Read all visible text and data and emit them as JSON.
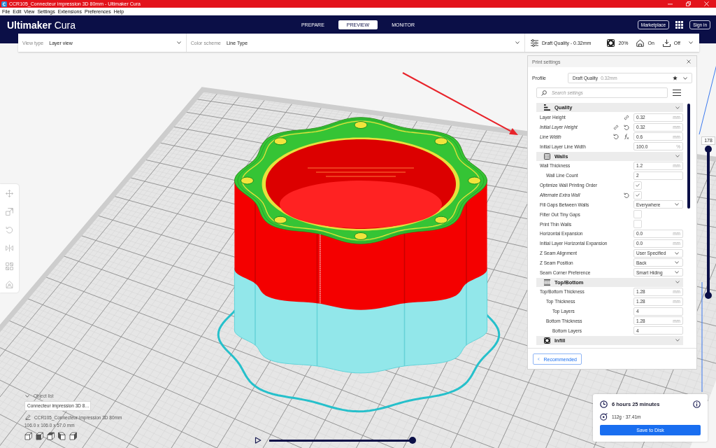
{
  "window": {
    "title": "CCR105_Connecteur impression 3D 80mm - Ultimaker Cura"
  },
  "menu": [
    "File",
    "Edit",
    "View",
    "Settings",
    "Extensions",
    "Preferences",
    "Help"
  ],
  "header": {
    "logo": "**Ultimaker** Cura",
    "tabs": [
      {
        "label": "PREPARE",
        "selected": false
      },
      {
        "label": "PREVIEW",
        "selected": true
      },
      {
        "label": "MONITOR",
        "selected": false
      }
    ],
    "marketplace": "Marketplace",
    "sign_in": "Sign in"
  },
  "view_bar": {
    "view_type": {
      "label": "View type",
      "value": "Layer view"
    },
    "color_scheme": {
      "label": "Color scheme",
      "value": "Line Type"
    },
    "print_setup": [
      {
        "kind": "profile",
        "value": "Draft Quality - 0.32mm"
      },
      {
        "kind": "infill",
        "value": "20%"
      },
      {
        "kind": "support",
        "value": "On"
      },
      {
        "kind": "adhesion",
        "value": "Off"
      }
    ]
  },
  "tools": [
    {
      "kind": "move",
      "disabled": true
    },
    {
      "kind": "scale",
      "disabled": true
    },
    {
      "kind": "rotate",
      "disabled": true
    },
    {
      "kind": "mirror",
      "disabled": true
    },
    {
      "kind": "permodel",
      "disabled": true
    },
    {
      "kind": "blocker",
      "disabled": true
    }
  ],
  "print_settings": {
    "title": "Print settings",
    "profile_label": "Profile",
    "profile": "Draft Quality",
    "profile_detail": "0.32mm",
    "search": {
      "placeholder": "Search settings"
    },
    "sections": [
      {
        "kind": "quality",
        "title": "Quality",
        "expanded": true,
        "settings": [
          {
            "label": "Layer Height",
            "kind": "number",
            "value": "0.32",
            "unit": "mm",
            "shared": true,
            "modified": false,
            "calculated": false
          },
          {
            "label": "Initial Layer Height",
            "kind": "number",
            "value": "0.32",
            "unit": "mm",
            "shared": true,
            "modified": true,
            "calculated": false
          },
          {
            "label": "Line Width",
            "kind": "number",
            "value": "0.6",
            "unit": "mm",
            "shared": false,
            "modified": true,
            "calculated": true
          },
          {
            "label": "Initial Layer Line Width",
            "kind": "number",
            "value": "100.0",
            "unit": "%",
            "shared": false,
            "modified": false,
            "calculated": false
          }
        ]
      },
      {
        "kind": "walls",
        "title": "Walls",
        "expanded": true,
        "settings": [
          {
            "label": "Wall Thickness",
            "kind": "number",
            "value": "1.2",
            "unit": "mm",
            "shared": false,
            "modified": false,
            "calculated": false,
            "children": [
              {
                "label": "Wall Line Count",
                "kind": "number",
                "value": "2",
                "shared": false,
                "modified": false,
                "calculated": false
              }
            ]
          },
          {
            "label": "Optimize Wall Printing Order",
            "kind": "checkbox",
            "checked": true,
            "shared": false,
            "modified": false,
            "calculated": false
          },
          {
            "label": "Alternate Extra Wall",
            "kind": "checkbox",
            "checked": true,
            "shared": false,
            "modified": true,
            "calculated": false
          },
          {
            "label": "Fill Gaps Between Walls",
            "kind": "dropdown",
            "value": "Everywhere",
            "shared": false,
            "modified": false,
            "calculated": false
          },
          {
            "label": "Filter Out Tiny Gaps",
            "kind": "checkbox",
            "checked": false,
            "shared": false,
            "modified": false,
            "calculated": false
          },
          {
            "label": "Print Thin Walls",
            "kind": "checkbox",
            "checked": false,
            "shared": false,
            "modified": false,
            "calculated": false
          },
          {
            "label": "Horizontal Expansion",
            "kind": "number",
            "value": "0.0",
            "unit": "mm",
            "shared": false,
            "modified": false,
            "calculated": false
          },
          {
            "label": "Initial Layer Horizontal Expansion",
            "kind": "number",
            "value": "0.0",
            "unit": "mm",
            "shared": false,
            "modified": false,
            "calculated": false
          },
          {
            "label": "Z Seam Alignment",
            "kind": "dropdown",
            "value": "User Specified",
            "shared": false,
            "modified": false,
            "calculated": false
          },
          {
            "label": "Z Seam Position",
            "kind": "dropdown",
            "value": "Back",
            "shared": false,
            "modified": false,
            "calculated": false
          },
          {
            "label": "Seam Corner Preference",
            "kind": "dropdown",
            "value": "Smart Hiding",
            "shared": false,
            "modified": false,
            "calculated": false
          }
        ]
      },
      {
        "kind": "topbottom",
        "title": "Top/Bottom",
        "expanded": true,
        "settings": [
          {
            "label": "Top/Bottom Thickness",
            "kind": "number",
            "value": "1.28",
            "unit": "mm",
            "shared": false,
            "modified": false,
            "calculated": false,
            "children": [
              {
                "label": "Top Thickness",
                "kind": "number",
                "value": "1.28",
                "unit": "mm",
                "shared": false,
                "modified": false,
                "calculated": false,
                "children": [
                  {
                    "label": "Top Layers",
                    "kind": "number",
                    "value": "4",
                    "shared": false,
                    "modified": false,
                    "calculated": false
                  }
                ]
              },
              {
                "label": "Bottom Thickness",
                "kind": "number",
                "value": "1.28",
                "unit": "mm",
                "shared": false,
                "modified": false,
                "calculated": false,
                "children": [
                  {
                    "label": "Bottom Layers",
                    "kind": "number",
                    "value": "4",
                    "shared": false,
                    "modified": false,
                    "calculated": false
                  }
                ]
              }
            ]
          }
        ]
      },
      {
        "kind": "infill",
        "title": "Infill",
        "expanded": true
      }
    ],
    "recommended": "Recommended"
  },
  "layer_slider": {
    "label": "178",
    "level": 1
  },
  "object_list": {
    "title": "Object list",
    "expanded": true,
    "item": "Connecteur impression 3D 8…",
    "name": "CCR105_Connecteur impression 3D 80mm",
    "dimensions": "106.0 x 106.0 x 57.0 mm"
  },
  "camera_views": [
    {
      "kind": "perspective"
    },
    {
      "kind": "front"
    },
    {
      "kind": "top"
    },
    {
      "kind": "left"
    },
    {
      "kind": "right"
    }
  ],
  "playback": {
    "level": 1
  },
  "estimate": {
    "time": "6 hours 25 minutes",
    "material": "112g · 37.41m",
    "save": "Save to Disk"
  }
}
